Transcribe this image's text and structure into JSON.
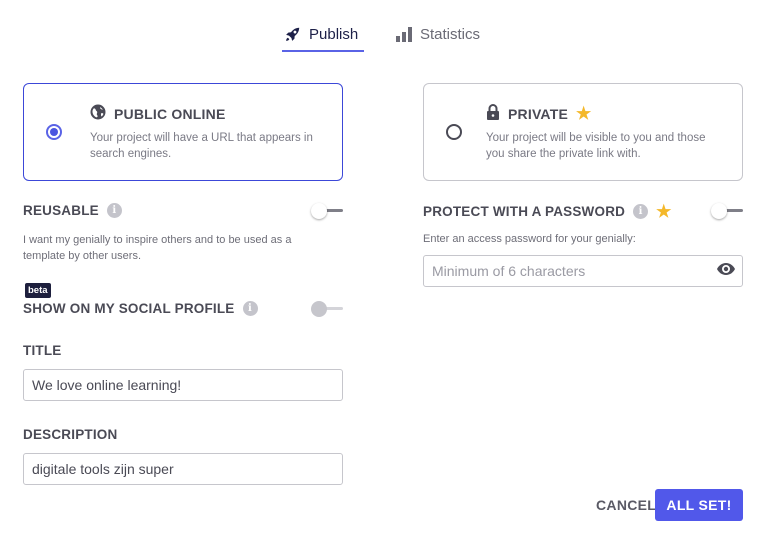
{
  "tabs": {
    "publish": {
      "label": "Publish",
      "icon": "rocket-icon",
      "active": true
    },
    "statistics": {
      "label": "Statistics",
      "icon": "bar-chart-icon",
      "active": false
    }
  },
  "visibility": {
    "public": {
      "title": "PUBLIC ONLINE",
      "description": "Your project will have a URL that appears in search engines.",
      "icon": "globe-icon",
      "selected": true
    },
    "private": {
      "title": "PRIVATE",
      "description": "Your project will be visible to you and those you share the private link with.",
      "icon": "lock-icon",
      "premium": true,
      "selected": false
    }
  },
  "reusable": {
    "label": "REUSABLE",
    "help": "I want my genially to inspire others and to be used as a template by other users.",
    "enabled": false
  },
  "social": {
    "badge": "beta",
    "label": "SHOW ON MY SOCIAL PROFILE",
    "enabled": false,
    "disabled": true
  },
  "title_field": {
    "label": "TITLE",
    "value": "We love online learning!"
  },
  "description_field": {
    "label": "DESCRIPTION",
    "value": "digitale tools zijn super"
  },
  "password": {
    "label": "PROTECT WITH A PASSWORD",
    "help": "Enter an access password for your genially:",
    "placeholder": "Minimum of 6 characters",
    "value": "",
    "premium": true,
    "enabled": false
  },
  "footer": {
    "cancel_label": "CANCEL",
    "confirm_label": "ALL SET!"
  },
  "colors": {
    "accent": "#5158ea",
    "selected_border": "#3c48d8",
    "premium_star": "#f4b82a",
    "badge_bg": "#1d1f3d"
  }
}
